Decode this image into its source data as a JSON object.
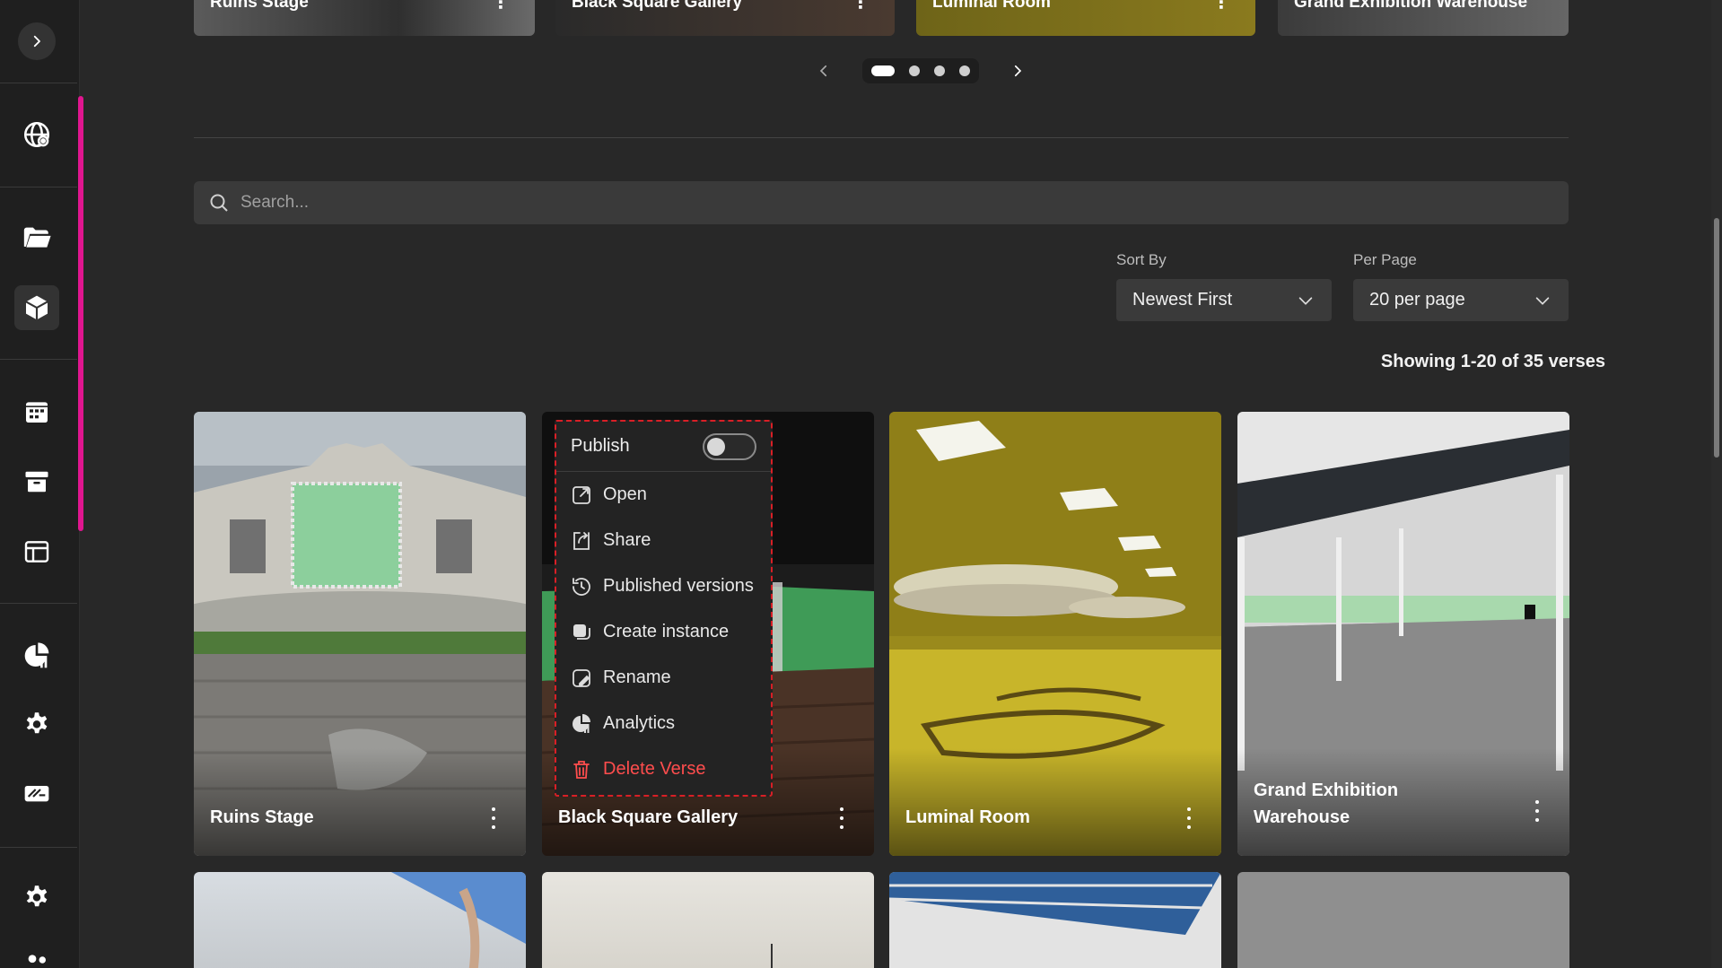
{
  "sidebar": {
    "expand_icon": "chevron-right-icon",
    "items": [
      {
        "icon": "globe-network-icon"
      },
      {
        "icon": "folder-open-icon"
      },
      {
        "icon": "cube-icon",
        "active": true
      },
      {
        "icon": "calendar-icon"
      },
      {
        "icon": "archive-icon"
      },
      {
        "icon": "layout-table-icon"
      },
      {
        "icon": "analytics-icon"
      },
      {
        "icon": "gear-icon"
      },
      {
        "icon": "ticket-icon"
      },
      {
        "icon": "settings-gear-icon"
      },
      {
        "icon": "users-icon"
      }
    ],
    "accent": "#e0168f"
  },
  "carousel": {
    "cards": [
      {
        "label": "Ruins Stage"
      },
      {
        "label": "Black Square Gallery"
      },
      {
        "label": "Luminal Room"
      },
      {
        "label": "Grand Exhibition Warehouse"
      }
    ],
    "pages": 4,
    "active_page": 1
  },
  "search": {
    "placeholder": "Search..."
  },
  "sort": {
    "label": "Sort By",
    "value": "Newest First"
  },
  "per_page": {
    "label": "Per Page",
    "value": "20 per page"
  },
  "showing": "Showing 1-20 of 35 verses",
  "grid": {
    "cards": [
      {
        "title": "Ruins Stage"
      },
      {
        "title": "Black Square Gallery"
      },
      {
        "title": "Luminal Room"
      },
      {
        "title": "Grand Exhibition Warehouse"
      }
    ]
  },
  "context_menu": {
    "publish_label": "Publish",
    "publish_on": false,
    "items": [
      {
        "label": "Open",
        "icon": "external-link-icon"
      },
      {
        "label": "Share",
        "icon": "share-icon"
      },
      {
        "label": "Published versions",
        "icon": "history-icon"
      },
      {
        "label": "Create instance",
        "icon": "copy-icon"
      },
      {
        "label": "Rename",
        "icon": "edit-icon"
      },
      {
        "label": "Analytics",
        "icon": "analytics-icon"
      },
      {
        "label": "Delete Verse",
        "icon": "trash-icon",
        "danger": true
      }
    ],
    "danger_color": "#ff4d4d",
    "outline_color": "#d81f26"
  }
}
